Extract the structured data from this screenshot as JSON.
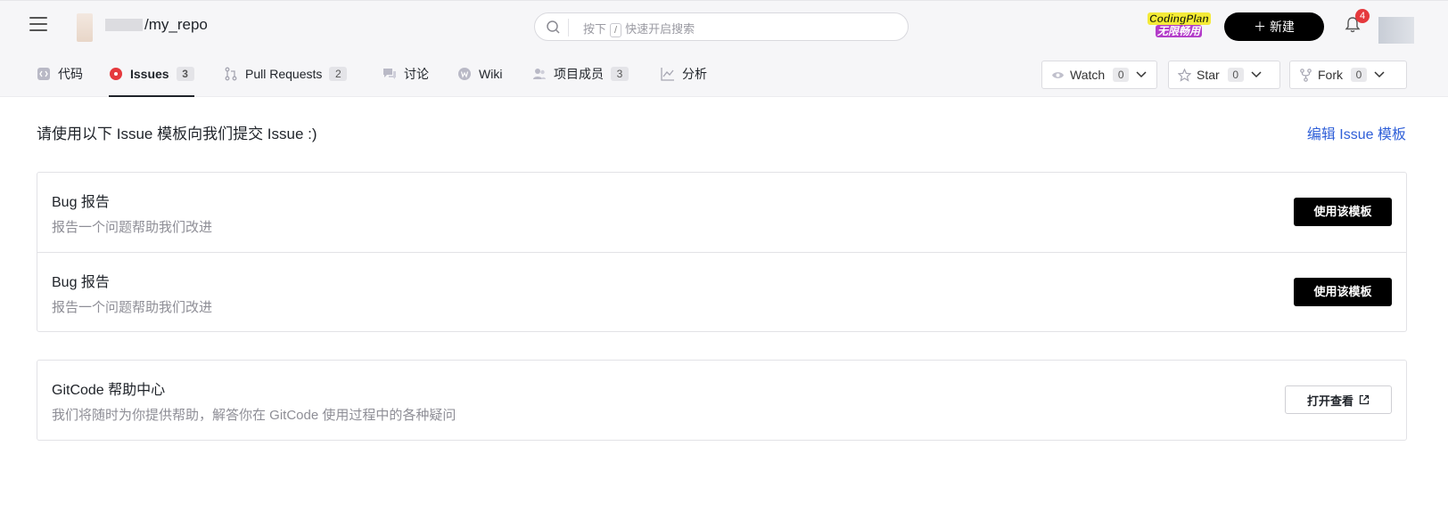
{
  "header": {
    "repo_path": "/my_repo",
    "search_placeholder_pre": "按下",
    "search_key": "/",
    "search_placeholder_post": "快速开启搜索",
    "promo_line1": "CodingPlan",
    "promo_line2": "无限畅用",
    "new_button": "新建",
    "notification_count": "4"
  },
  "tabs": [
    {
      "label": "代码",
      "icon": "code-icon"
    },
    {
      "label": "Issues",
      "count": "3",
      "icon": "issues-icon",
      "active": true
    },
    {
      "label": "Pull Requests",
      "count": "2",
      "icon": "pull-request-icon"
    },
    {
      "label": "讨论",
      "icon": "discussion-icon"
    },
    {
      "label": "Wiki",
      "icon": "wiki-icon"
    },
    {
      "label": "项目成员",
      "count": "3",
      "icon": "members-icon"
    },
    {
      "label": "分析",
      "icon": "analytics-icon"
    }
  ],
  "repo_actions": {
    "watch": {
      "label": "Watch",
      "count": "0"
    },
    "star": {
      "label": "Star",
      "count": "0"
    },
    "fork": {
      "label": "Fork",
      "count": "0"
    }
  },
  "main": {
    "headline": "请使用以下 Issue 模板向我们提交 Issue :)",
    "edit_link": "编辑 Issue 模板",
    "templates": [
      {
        "title": "Bug 报告",
        "desc": "报告一个问题帮助我们改进",
        "button": "使用该模板"
      },
      {
        "title": "Bug 报告",
        "desc": "报告一个问题帮助我们改进",
        "button": "使用该模板"
      }
    ],
    "help": {
      "title": "GitCode 帮助中心",
      "desc": "我们将随时为你提供帮助，解答你在 GitCode 使用过程中的各种疑问",
      "button": "打开查看"
    }
  },
  "colors": {
    "accent_link": "#2f5fd8",
    "issues_icon": "#e5393d",
    "primary_button": "#000000"
  }
}
